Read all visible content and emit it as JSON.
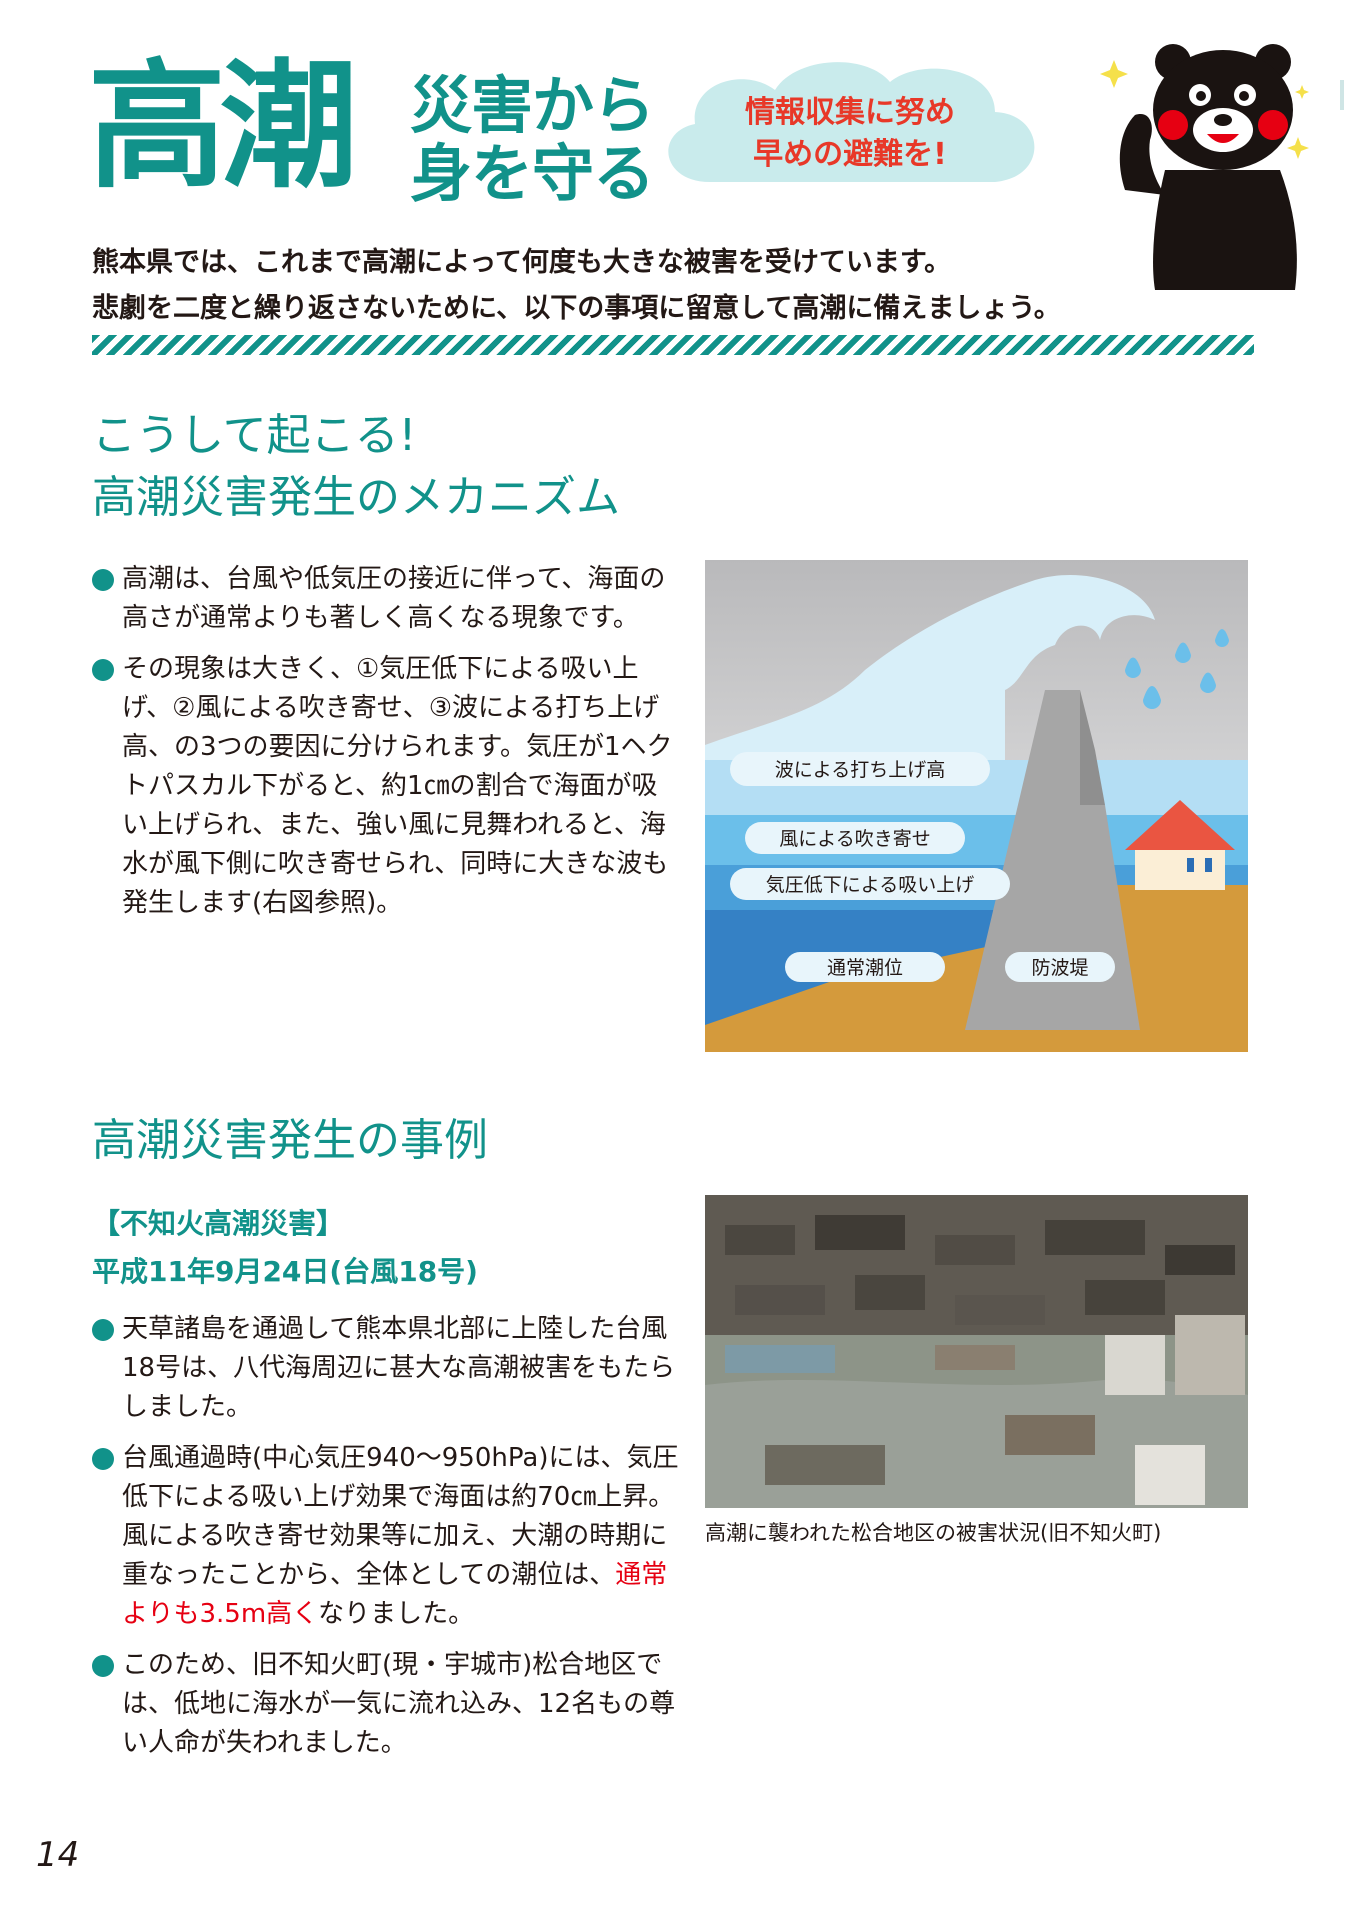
{
  "header": {
    "title_main": "高潮",
    "title_sub_line1": "災害から",
    "title_sub_line2": "身を守る",
    "cloud_line1": "情報収集に努め",
    "cloud_line2": "早めの避難を!"
  },
  "intro": {
    "line1": "熊本県では、これまで高潮によって何度も大きな被害を受けています。",
    "line2": "悲劇を二度と繰り返さないために、以下の事項に留意して高潮に備えましょう。"
  },
  "mechanism": {
    "title_line1": "こうして起こる!",
    "title_line2": "高潮災害発生のメカニズム",
    "bullets": [
      "高潮は、台風や低気圧の接近に伴って、海面の高さが通常よりも著しく高くなる現象です。",
      "その現象は大きく、①気圧低下による吸い上げ、②風による吹き寄せ、③波による打ち上げ高、の3つの要因に分けられます。気圧が1ヘクトパスカル下がると、約1㎝の割合で海面が吸い上げられ、また、強い風に見舞われると、海水が風下側に吹き寄せられ、同時に大きな波も発生します(右図参照)。"
    ],
    "diagram_labels": {
      "wave": "波による打ち上げ高",
      "wind": "風による吹き寄せ",
      "pressure": "気圧低下による吸い上げ",
      "normal": "通常潮位",
      "breakwater": "防波堤"
    }
  },
  "cases": {
    "title": "高潮災害発生の事例",
    "case_name": "【不知火高潮災害】",
    "case_date": "平成11年9月24日(台風18号)",
    "bullet1": "天草諸島を通過して熊本県北部に上陸した台風18号は、八代海周辺に甚大な高潮被害をもたらしました。",
    "bullet2_a": "台風通過時(中心気圧940～950hPa)には、気圧低下による吸い上げ効果で海面は約70㎝上昇。風による吹き寄せ効果等に加え、大潮の時期に重なったことから、全体としての潮位は、",
    "bullet2_red": "通常よりも3.5m高く",
    "bullet2_b": "なりました。",
    "bullet3": "このため、旧不知火町(現・宇城市)松合地区では、低地に海水が一気に流れ込み、12名もの尊い人命が失われました。",
    "photo_caption": "高潮に襲われた松合地区の被害状況(旧不知火町)"
  },
  "footer": {
    "page_number": "14"
  },
  "colors": {
    "accent": "#11928a",
    "alert": "#e60012",
    "cloud": "#c9ebec"
  }
}
